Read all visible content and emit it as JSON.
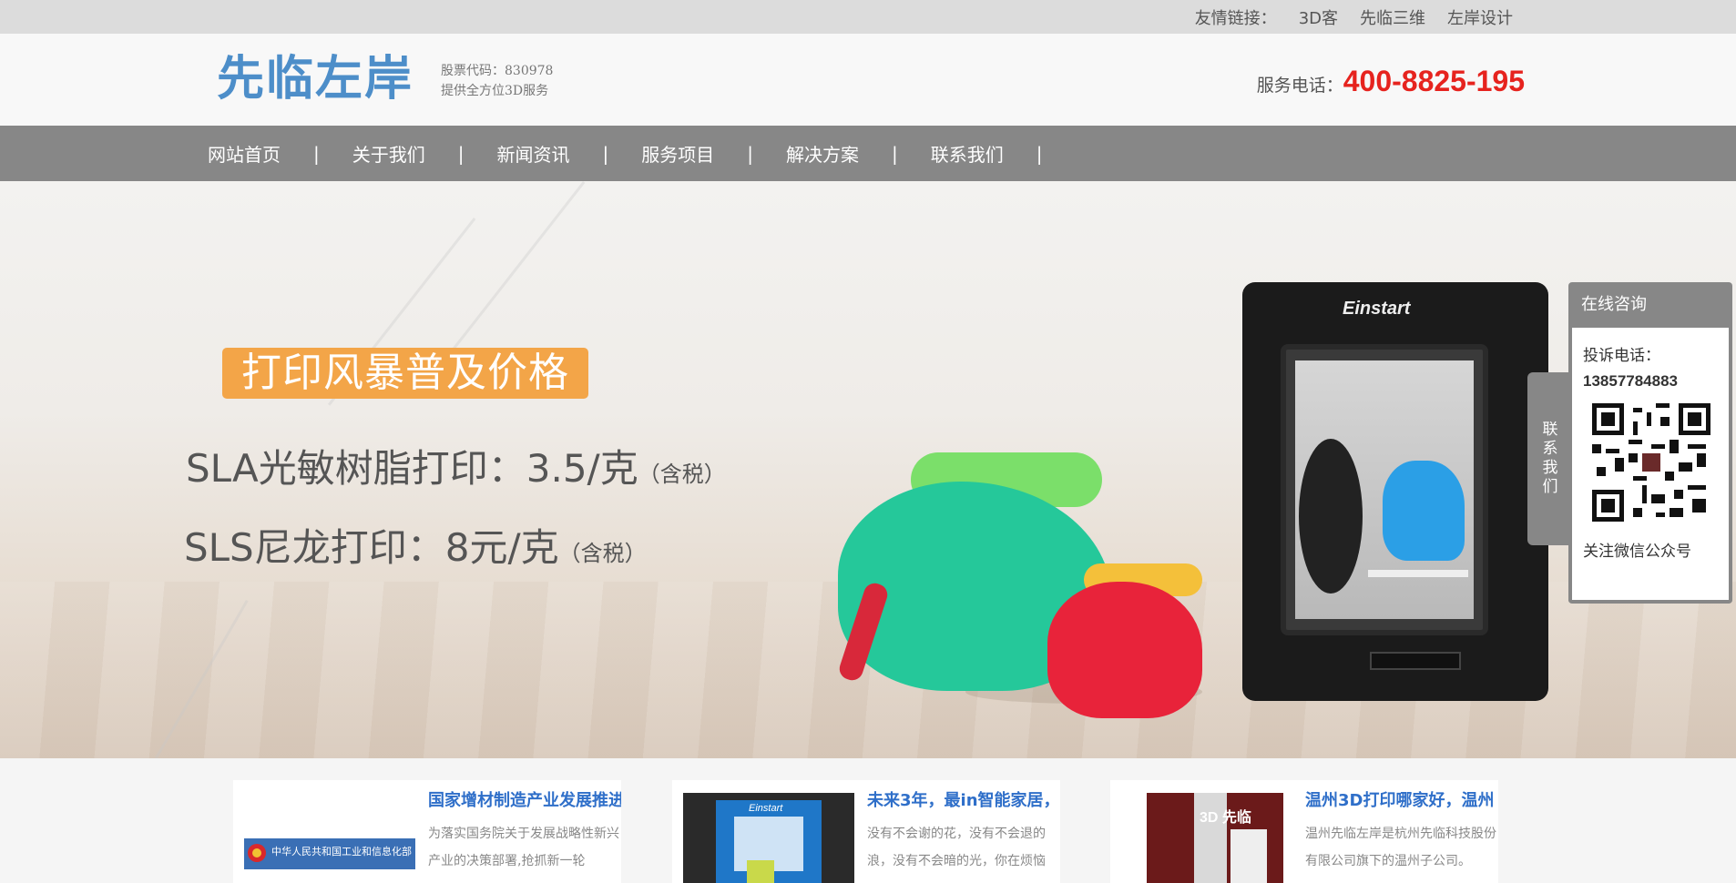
{
  "topbar": {
    "label": "友情链接：",
    "links": [
      "3D客",
      "先临三维",
      "左岸设计"
    ]
  },
  "header": {
    "logo": "先临左岸",
    "stock_code": "股票代码：830978",
    "tagline": "提供全方位3D服务",
    "hotline_label": "服务电话：",
    "hotline_number": "400-8825-195"
  },
  "nav": {
    "items": [
      "网站首页",
      "关于我们",
      "新闻资讯",
      "服务项目",
      "解决方案",
      "联系我们"
    ],
    "separator": "|"
  },
  "banner": {
    "promo": "打印风暴普及价格",
    "line1_main": "SLA光敏树脂打印：3.5/克",
    "line1_tax": "（含税）",
    "line2_main": "SLS尼龙打印：8元/克",
    "line2_tax": "（含税）",
    "printer_brand": "Einstart",
    "slide_count": 3,
    "active_slide": 2
  },
  "contact": {
    "tab": "联系我们",
    "head": "在线咨询",
    "complaint_label": "投诉电话：",
    "complaint_number": "13857784883",
    "wechat_label": "关注微信公众号"
  },
  "news": [
    {
      "title": "国家增材制造产业发展推进",
      "desc": "为落实国务院关于发展战略性新兴产业的决策部署,抢抓新一轮",
      "thumb_text": "中华人民共和国工业和信息化部"
    },
    {
      "title": "未来3年，最in智能家居，",
      "desc": "没有不会谢的花，没有不会退的浪，没有不会暗的光，你在烦恼",
      "thumb_text": "Einstart"
    },
    {
      "title": "温州3D打印哪家好，温州",
      "desc": "温州先临左岸是杭州先临科技股份有限公司旗下的温州子公司。",
      "thumb_text": "3D 先临"
    }
  ],
  "colors": {
    "accent_blue": "#4d8ec9",
    "hotline_red": "#e6231e",
    "nav_gray": "#878787",
    "promo_orange": "#f3a548",
    "news_title_blue": "#2f6fc9"
  }
}
